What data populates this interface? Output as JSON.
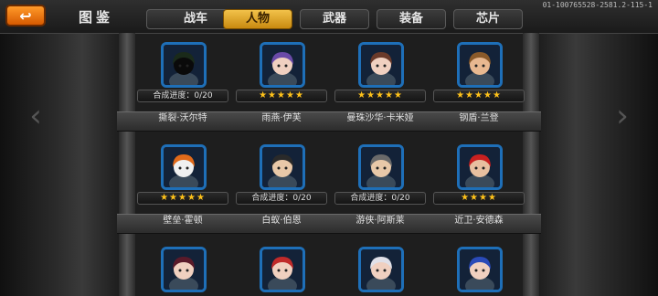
{
  "header": {
    "back_icon": "back-arrow-icon",
    "title": "图鉴",
    "server_id": "01-100765528-2581.2-115-1",
    "tabs": [
      {
        "label": "战车",
        "active": false
      },
      {
        "label": "人物",
        "active": true
      },
      {
        "label": "武器",
        "active": false
      },
      {
        "label": "装备",
        "active": false
      },
      {
        "label": "芯片",
        "active": false
      }
    ]
  },
  "colors": {
    "accent": "#f2a020",
    "star": "#ffc21a",
    "portrait_border": "#1e6fb8"
  },
  "rows": [
    {
      "cards": [
        {
          "name": "撕裂·沃尔特",
          "status": "合成进度：0/20",
          "stars": 0,
          "avatar": "hooded-figure"
        },
        {
          "name": "雨燕·伊芙",
          "status": "",
          "stars": 5,
          "avatar": "purple-hair-girl"
        },
        {
          "name": "曼珠沙华·卡米娅",
          "status": "",
          "stars": 5,
          "avatar": "brown-hair-girl"
        },
        {
          "name": "钢盾·兰登",
          "status": "",
          "stars": 5,
          "avatar": "bearded-soldier"
        }
      ]
    },
    {
      "cards": [
        {
          "name": "壁垒·霍顿",
          "status": "",
          "stars": 5,
          "avatar": "orange-robot"
        },
        {
          "name": "白蚁·伯恩",
          "status": "合成进度：0/20",
          "stars": 0,
          "avatar": "dark-hair-man"
        },
        {
          "name": "游侠·阿斯莱",
          "status": "合成进度：0/20",
          "stars": 0,
          "avatar": "hat-ranger"
        },
        {
          "name": "近卫·安德森",
          "status": "",
          "stars": 4,
          "avatar": "red-cap-soldier"
        }
      ]
    },
    {
      "cards": [
        {
          "name": "",
          "status": "",
          "stars": 0,
          "avatar": "dark-red-hair-girl"
        },
        {
          "name": "",
          "status": "",
          "stars": 0,
          "avatar": "red-hair-girl"
        },
        {
          "name": "",
          "status": "",
          "stars": 0,
          "avatar": "white-hair-girl"
        },
        {
          "name": "",
          "status": "",
          "stars": 0,
          "avatar": "blue-hair-girl"
        }
      ]
    }
  ]
}
